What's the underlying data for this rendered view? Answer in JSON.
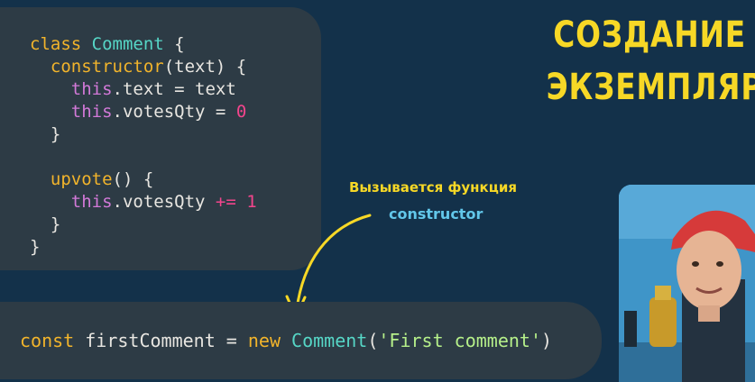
{
  "title": {
    "line1": "СОЗДАНИЕ",
    "line2": "ЭКЗЕМПЛЯРА"
  },
  "annotation": {
    "line1": "Вызывается функция",
    "line2": "constructor"
  },
  "code": {
    "l1": {
      "kw": "class",
      "name": "Comment",
      "brace": " {"
    },
    "l2": {
      "fn": "constructor",
      "args": "(text) {"
    },
    "l3": {
      "this": "this",
      "rest": ".text = text"
    },
    "l4": {
      "this": "this",
      "rest": ".votesQty = ",
      "num": "0"
    },
    "l5": {
      "text": "}"
    },
    "l7": {
      "fn": "upvote",
      "args": "() {"
    },
    "l8": {
      "this": "this",
      "rest": ".votesQty ",
      "op": "+=",
      "num": "1"
    },
    "l9": {
      "text": "}"
    },
    "l10": {
      "text": "}"
    }
  },
  "bottom": {
    "kw": "const",
    "var": " firstComment = ",
    "new": "new",
    "cls": " Comment",
    "open": "(",
    "str": "'First comment'",
    "close": ")"
  },
  "colors": {
    "background": "#13314a",
    "card": "#2d3b45",
    "keyword": "#f2b42b",
    "class_name": "#56d6c6",
    "this": "#d279d8",
    "number": "#f2458c",
    "string": "#b6f08a",
    "title": "#f7d826",
    "annotation_secondary": "#62c7ea"
  }
}
